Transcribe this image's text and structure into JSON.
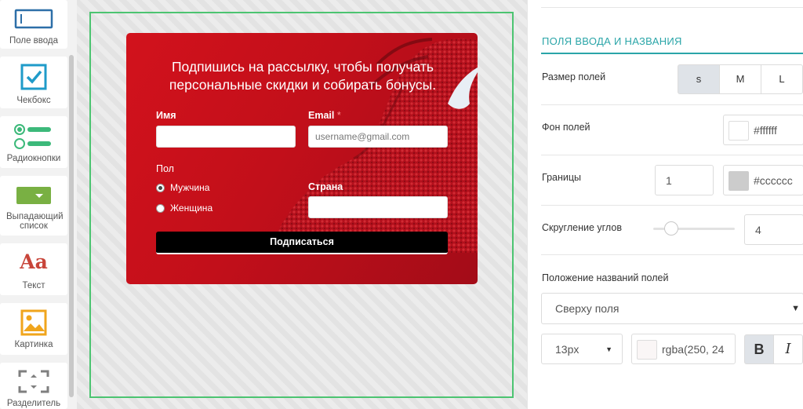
{
  "sidebar": {
    "tools": [
      {
        "label": "Поле ввода",
        "icon": "input-field-icon"
      },
      {
        "label": "Чекбокс",
        "icon": "checkbox-icon"
      },
      {
        "label": "Радиокнопки",
        "icon": "radio-buttons-icon"
      },
      {
        "label": "Выпадающий список",
        "icon": "dropdown-icon"
      },
      {
        "label": "Текст",
        "icon": "text-icon",
        "glyph": "Aa"
      },
      {
        "label": "Картинка",
        "icon": "image-icon"
      },
      {
        "label": "Разделитель",
        "icon": "divider-icon"
      }
    ]
  },
  "form": {
    "title": "Подпишись на рассылку, чтобы получать персональные скидки и собирать бонусы.",
    "name_label": "Имя",
    "email_label": "Email",
    "email_required": "*",
    "email_placeholder": "username@gmail.com",
    "gender_label": "Пол",
    "gender_options": [
      "Мужчина",
      "Женщина"
    ],
    "country_label": "Страна",
    "submit_label": "Подписаться"
  },
  "panel": {
    "section_title": "ПОЛЯ ВВОДА И НАЗВАНИЯ",
    "field_size": {
      "label": "Размер полей",
      "options": [
        "s",
        "M",
        "L"
      ],
      "selected": "s"
    },
    "field_bg": {
      "label": "Фон полей",
      "value": "#ffffff"
    },
    "borders": {
      "label": "Границы",
      "width": "1",
      "color": "#cccccc"
    },
    "radius": {
      "label": "Скругление углов",
      "value": "4"
    },
    "label_position": {
      "label": "Положение названий полей",
      "value": "Сверху поля"
    },
    "font": {
      "size": "13px",
      "color": "rgba(250, 24",
      "bold": "B",
      "italic": "I"
    }
  },
  "colors": {
    "accent": "#2aa5a8",
    "dropzone": "#4cc471",
    "form_bg": "#d2121c",
    "button": "#000000"
  }
}
